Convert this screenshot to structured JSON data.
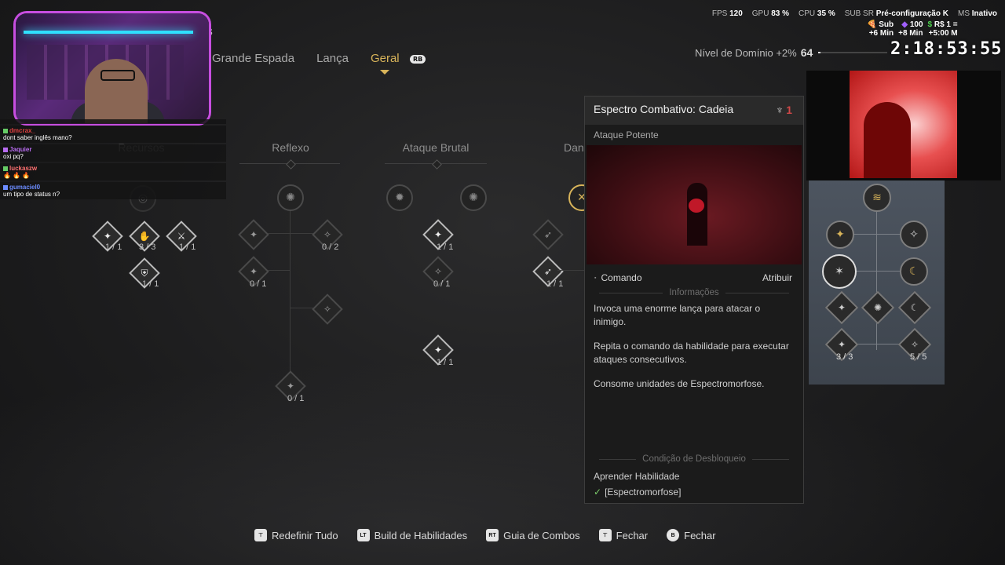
{
  "tabs": {
    "partial": "s",
    "items": [
      "Grande Espada",
      "Lança",
      "Geral"
    ],
    "active": "Geral",
    "rb": "RB"
  },
  "hud": {
    "fps_label": "FPS",
    "fps": "120",
    "gpu_label": "GPU",
    "gpu": "83 %",
    "cpu_label": "CPU",
    "cpu": "35 %",
    "sub_label": "SUB SR",
    "sub_value": "Pré-configuração K",
    "ms_label": "MS",
    "ms_value": "Inativo"
  },
  "dominio": {
    "label": "Nível de Domínio +2%",
    "value": "64",
    "progress": 0.03
  },
  "stream_overlay": {
    "sub_label": "Sub",
    "sub_time": "+6 Min",
    "bits": "100",
    "bits_time": "+8 Min",
    "money": "R$ 1 =",
    "money_time": "+5:00 M",
    "timer": "2:18:53:55"
  },
  "chat": [
    {
      "user": "dmcrax_",
      "text": "dont saber inglês mano?",
      "color": "#e04040"
    },
    {
      "user": "Jaquier",
      "text": "oxi pq?",
      "color": "#b86cf0"
    },
    {
      "user": "luckaszw",
      "text": "🔥 🔥 🔥",
      "color": "#ff7070"
    },
    {
      "user": "gumaciel0",
      "text": "um tipo de status n?",
      "color": "#6c8cff"
    }
  ],
  "columns": {
    "recursos": "Recursos",
    "reflexo": "Reflexo",
    "ataque_brutal": "Ataque Brutal",
    "dan": "Dan"
  },
  "counts": {
    "r1": "1 / 1",
    "r2": "3 / 3",
    "r3": "1 / 1",
    "r4": "1 / 1",
    "f1": "0 / 2",
    "f2": "0 / 1",
    "f3": "0 / 1",
    "a1": "1 / 1",
    "a2": "0 / 1",
    "a3": "1 / 1",
    "d1": "1 / 1",
    "p1": "3 / 3",
    "p2": "5 / 5"
  },
  "tooltip": {
    "title": "Espectro Combativo: Cadeia",
    "tree_count": "1",
    "subtitle": "Ataque Potente",
    "command_label": "Comando",
    "command_action": "Atribuir",
    "info_header": "Informações",
    "desc1": "Invoca uma enorme lança para atacar o inimigo.",
    "desc2": "Repita o comando da habilidade para executar ataques consecutivos.",
    "desc3": "Consome unidades de Espectromorfose.",
    "unlock_header": "Condição de Desbloqueio",
    "unlock_req": "Aprender Habilidade",
    "unlock_item": "[Espectromorfose]"
  },
  "bottom": [
    {
      "key": "⊤",
      "label": "Redefinir Tudo"
    },
    {
      "key": "LT",
      "label": "Build de Habilidades"
    },
    {
      "key": "RT",
      "label": "Guia de Combos"
    },
    {
      "key": "⊤",
      "label": "Fechar"
    },
    {
      "key": "B",
      "label": "Fechar"
    }
  ],
  "colors": {
    "accent": "#d8b45a",
    "red": "#d04848"
  }
}
